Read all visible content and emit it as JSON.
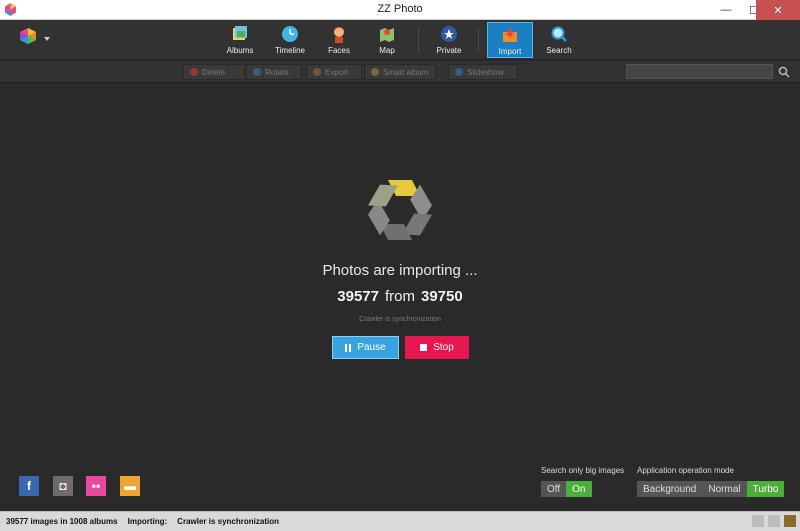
{
  "window": {
    "title": "ZZ Photo",
    "minimize": "—",
    "maximize": "☐",
    "close": "✕"
  },
  "nav": {
    "items": [
      {
        "label": "Albums",
        "icon": "albums-icon"
      },
      {
        "label": "Timeline",
        "icon": "timeline-icon"
      },
      {
        "label": "Faces",
        "icon": "faces-icon"
      },
      {
        "label": "Map",
        "icon": "map-icon"
      },
      {
        "label": "Private",
        "icon": "private-icon"
      },
      {
        "label": "Import",
        "icon": "import-icon",
        "active": true
      },
      {
        "label": "Search",
        "icon": "search-icon"
      }
    ]
  },
  "subbar": {
    "delete": "Delete",
    "rotate": "Rotate",
    "export": "Export",
    "smart_album": "Smart album",
    "slideshow": "Slideshow",
    "search_placeholder": ""
  },
  "import": {
    "title": "Photos are importing ...",
    "current": "39577",
    "from_word": "from",
    "total": "39750",
    "note": "Crawler is synchronization",
    "pause_label": "Pause",
    "stop_label": "Stop"
  },
  "social": {
    "facebook": "f",
    "instagram": "◘",
    "flickr": "••",
    "folder": "▬"
  },
  "big_images": {
    "label": "Search only big images",
    "off": "Off",
    "on": "On",
    "selected": "On"
  },
  "operation_mode": {
    "label": "Application operation mode",
    "options": [
      "Background",
      "Normal",
      "Turbo"
    ],
    "selected": "Turbo"
  },
  "status": {
    "summary": "39577 images in 1008 albums",
    "importing_label": "Importing:",
    "importing_value": "Crawler is synchronization"
  },
  "colors": {
    "accent": "#1a7fc3",
    "pause": "#39a3df",
    "stop": "#e8174f",
    "toggle_on": "#4caf3b"
  }
}
